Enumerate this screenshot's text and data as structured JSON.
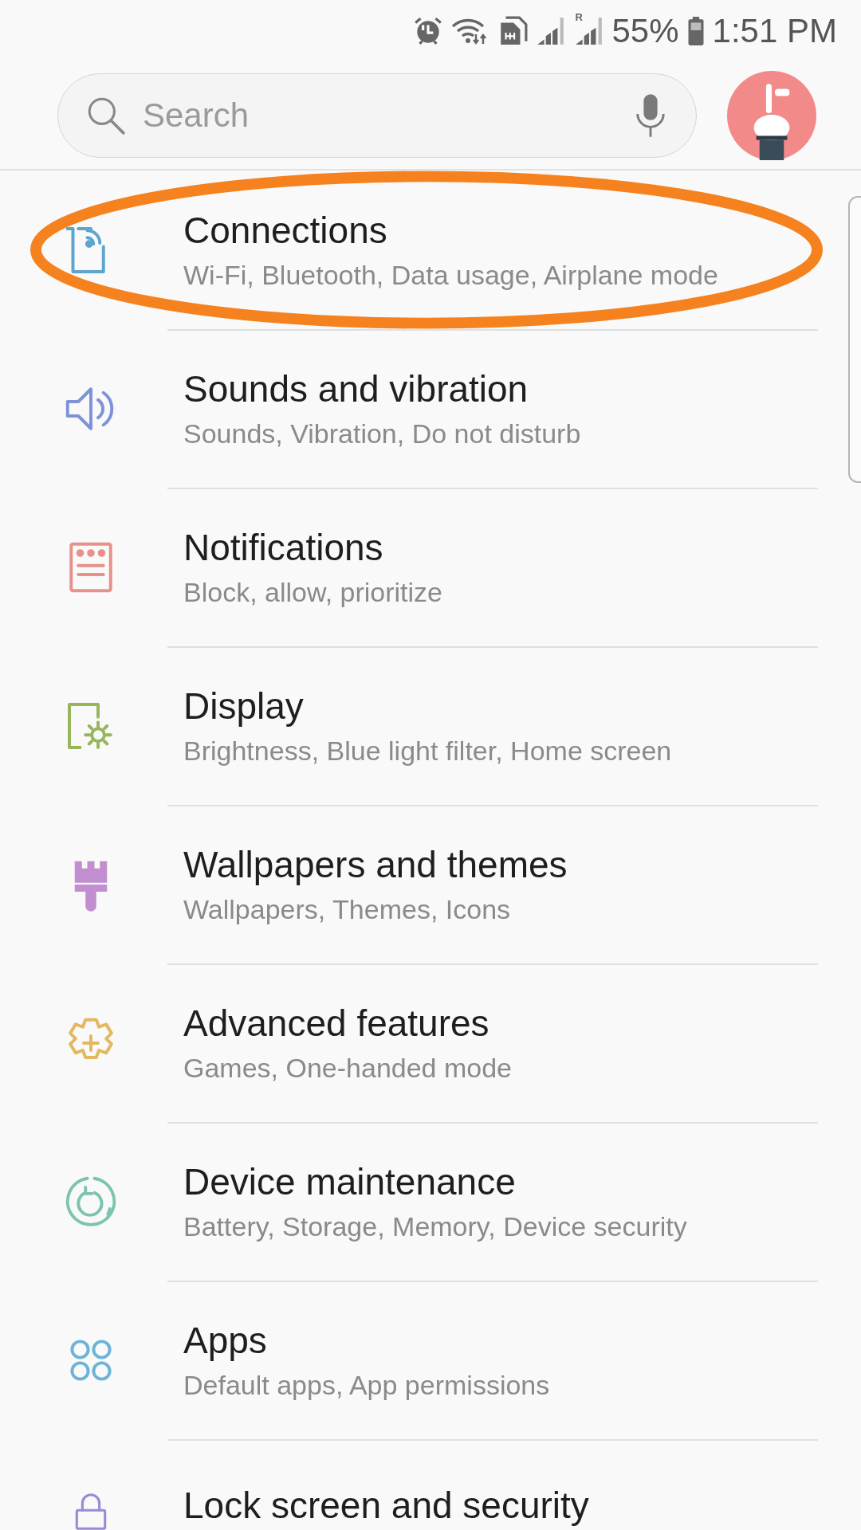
{
  "status_bar": {
    "battery_percent": "55%",
    "time": "1:51 PM",
    "roaming_label": "R"
  },
  "search": {
    "placeholder": "Search"
  },
  "settings_items": [
    {
      "title": "Connections",
      "subtitle": "Wi-Fi, Bluetooth, Data usage, Airplane mode",
      "highlighted": true
    },
    {
      "title": "Sounds and vibration",
      "subtitle": "Sounds, Vibration, Do not disturb",
      "highlighted": false
    },
    {
      "title": "Notifications",
      "subtitle": "Block, allow, prioritize",
      "highlighted": false
    },
    {
      "title": "Display",
      "subtitle": "Brightness, Blue light filter, Home screen",
      "highlighted": false
    },
    {
      "title": "Wallpapers and themes",
      "subtitle": "Wallpapers, Themes, Icons",
      "highlighted": false
    },
    {
      "title": "Advanced features",
      "subtitle": "Games, One-handed mode",
      "highlighted": false
    },
    {
      "title": "Device maintenance",
      "subtitle": "Battery, Storage, Memory, Device security",
      "highlighted": false
    },
    {
      "title": "Apps",
      "subtitle": "Default apps, App permissions",
      "highlighted": false
    },
    {
      "title": "Lock screen and security",
      "highlighted": false
    }
  ]
}
